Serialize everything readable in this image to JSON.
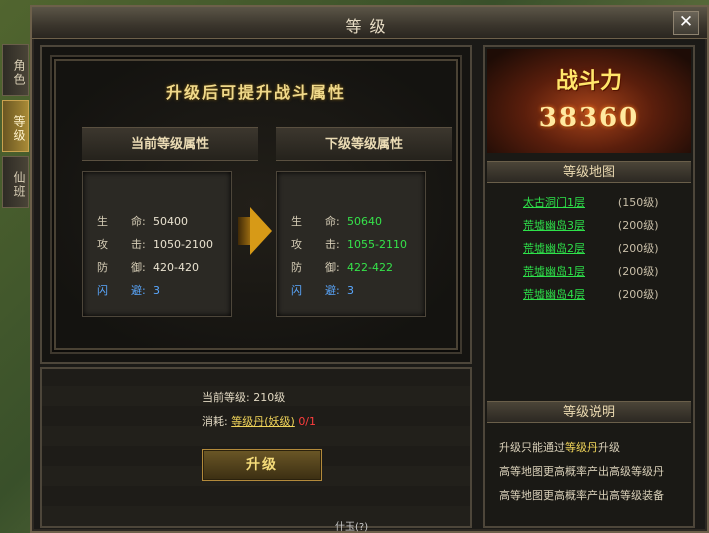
{
  "window": {
    "title": "等级",
    "close_glyph": "✕"
  },
  "side_tabs": [
    {
      "label": "角色",
      "active": false
    },
    {
      "label": "等级",
      "active": true
    },
    {
      "label": "仙班",
      "active": false
    }
  ],
  "main": {
    "headline": "升级后可提升战斗属性",
    "current": {
      "header": "当前等级属性",
      "rows": [
        {
          "k1": "生",
          "k2": "命:",
          "v": "50400"
        },
        {
          "k1": "攻",
          "k2": "击:",
          "v": "1050-2100"
        },
        {
          "k1": "防",
          "k2": "御:",
          "v": "420-420"
        },
        {
          "k1": "闪",
          "k2": "避:",
          "v": "3"
        }
      ]
    },
    "next": {
      "header": "下级等级属性",
      "rows": [
        {
          "k1": "生",
          "k2": "命:",
          "v": "50640"
        },
        {
          "k1": "攻",
          "k2": "击:",
          "v": "1055-2110"
        },
        {
          "k1": "防",
          "k2": "御:",
          "v": "422-422"
        },
        {
          "k1": "闪",
          "k2": "避:",
          "v": "3"
        }
      ]
    }
  },
  "upgrade": {
    "current_level_text": "当前等级: 210级",
    "consume_label": "消耗:",
    "consume_item": "等级丹(妖级)",
    "consume_count": "0/1",
    "button_label": "升级"
  },
  "sidebar": {
    "combat_label": "战斗力",
    "combat_value": "38360",
    "map_header": "等级地图",
    "maps": [
      {
        "name": "太古洞门1层",
        "level": "(150级)"
      },
      {
        "name": "荒墟幽岛3层",
        "level": "(200级)"
      },
      {
        "name": "荒墟幽岛2层",
        "level": "(200级)"
      },
      {
        "name": "荒墟幽岛1层",
        "level": "(200级)"
      },
      {
        "name": "荒墟幽岛4层",
        "level": "(200级)"
      }
    ],
    "desc_header": "等级说明",
    "desc1_pre": "升级只能通过",
    "desc1_hl": "等级丹",
    "desc1_post": "升级",
    "desc2": "高等地图更高概率产出高级等级丹",
    "desc3": "高等地图更高概率产出高等级装备"
  },
  "footer_fragment": "什玉(?)"
}
